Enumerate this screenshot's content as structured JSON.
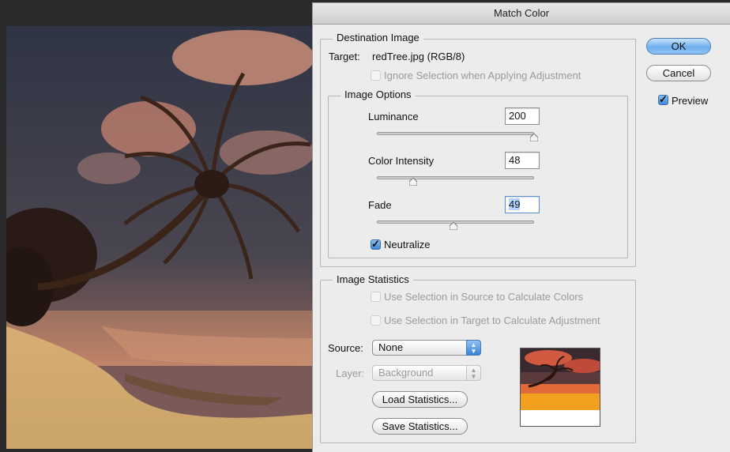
{
  "dialog": {
    "title": "Match Color",
    "ok_label": "OK",
    "cancel_label": "Cancel",
    "preview_label": "Preview",
    "preview_checked": true
  },
  "destination": {
    "title": "Destination Image",
    "target_label": "Target:",
    "target_value": "redTree.jpg (RGB/8)",
    "ignore_selection_label": "Ignore Selection when Applying Adjustment"
  },
  "image_options": {
    "title": "Image Options",
    "luminance": {
      "label": "Luminance",
      "value": "200",
      "level": 1.0
    },
    "color_intensity": {
      "label": "Color Intensity",
      "value": "48",
      "level": 0.24
    },
    "fade": {
      "label": "Fade",
      "value": "49",
      "level": 0.49
    },
    "neutralize_label": "Neutralize",
    "neutralize_checked": true
  },
  "statistics": {
    "title": "Image Statistics",
    "use_source_label": "Use Selection in Source to Calculate Colors",
    "use_target_label": "Use Selection in Target to Calculate Adjustment",
    "source_label": "Source:",
    "source_value": "None",
    "layer_label": "Layer:",
    "layer_value": "Background",
    "load_label": "Load Statistics...",
    "save_label": "Save Statistics..."
  },
  "colors": {
    "accent": "#3d86d9",
    "dialog_bg": "#ececec",
    "disabled_text": "#9b9b9b"
  }
}
